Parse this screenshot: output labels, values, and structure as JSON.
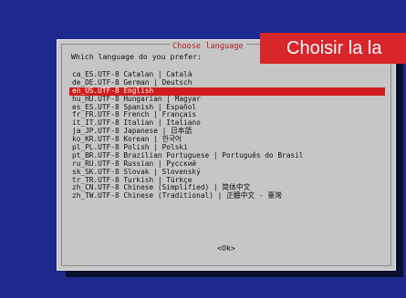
{
  "dialog": {
    "title": "Choose language",
    "prompt": "Which language do you prefer:",
    "ok_label": "<Ok>"
  },
  "languages": [
    "ca_ES.UTF-8 Catalan | Català",
    "de_DE.UTF-8 German | Deutsch",
    "en_US.UTF-8 English",
    "hu_HU.UTF-8 Hungarian | Magyar",
    "es_ES.UTF-8 Spanish | Español",
    "fr_FR.UTF-8 French | Français",
    "it_IT.UTF-8 Italian | Italiano",
    "ja_JP.UTF-8 Japanese | 日本語",
    "ko_KR.UTF-8 Korean | 한국어",
    "pl_PL.UTF-8 Polish | Polski",
    "pt_BR.UTF-8 Brazilian Portuguese | Português do Brasil",
    "ru_RU.UTF-8 Russian | Русский",
    "sk_SK.UTF-8 Slovak | Slovenský",
    "tr_TR.UTF-8 Turkish | Türkçe",
    "zh_CN.UTF-8 Chinese (Simplified) | 简体中文",
    "zh_TW.UTF-8 Chinese (Traditional) | 正體中文 - 臺灣"
  ],
  "selected_language": "en_US.UTF-8 English",
  "banner": {
    "text": "Choisir la la"
  },
  "colors": {
    "background": "#1b2a8c",
    "dialog": "#c6c6c6",
    "selection": "#d01c1c",
    "title": "#b01e1e",
    "banner": "#d8262b"
  }
}
